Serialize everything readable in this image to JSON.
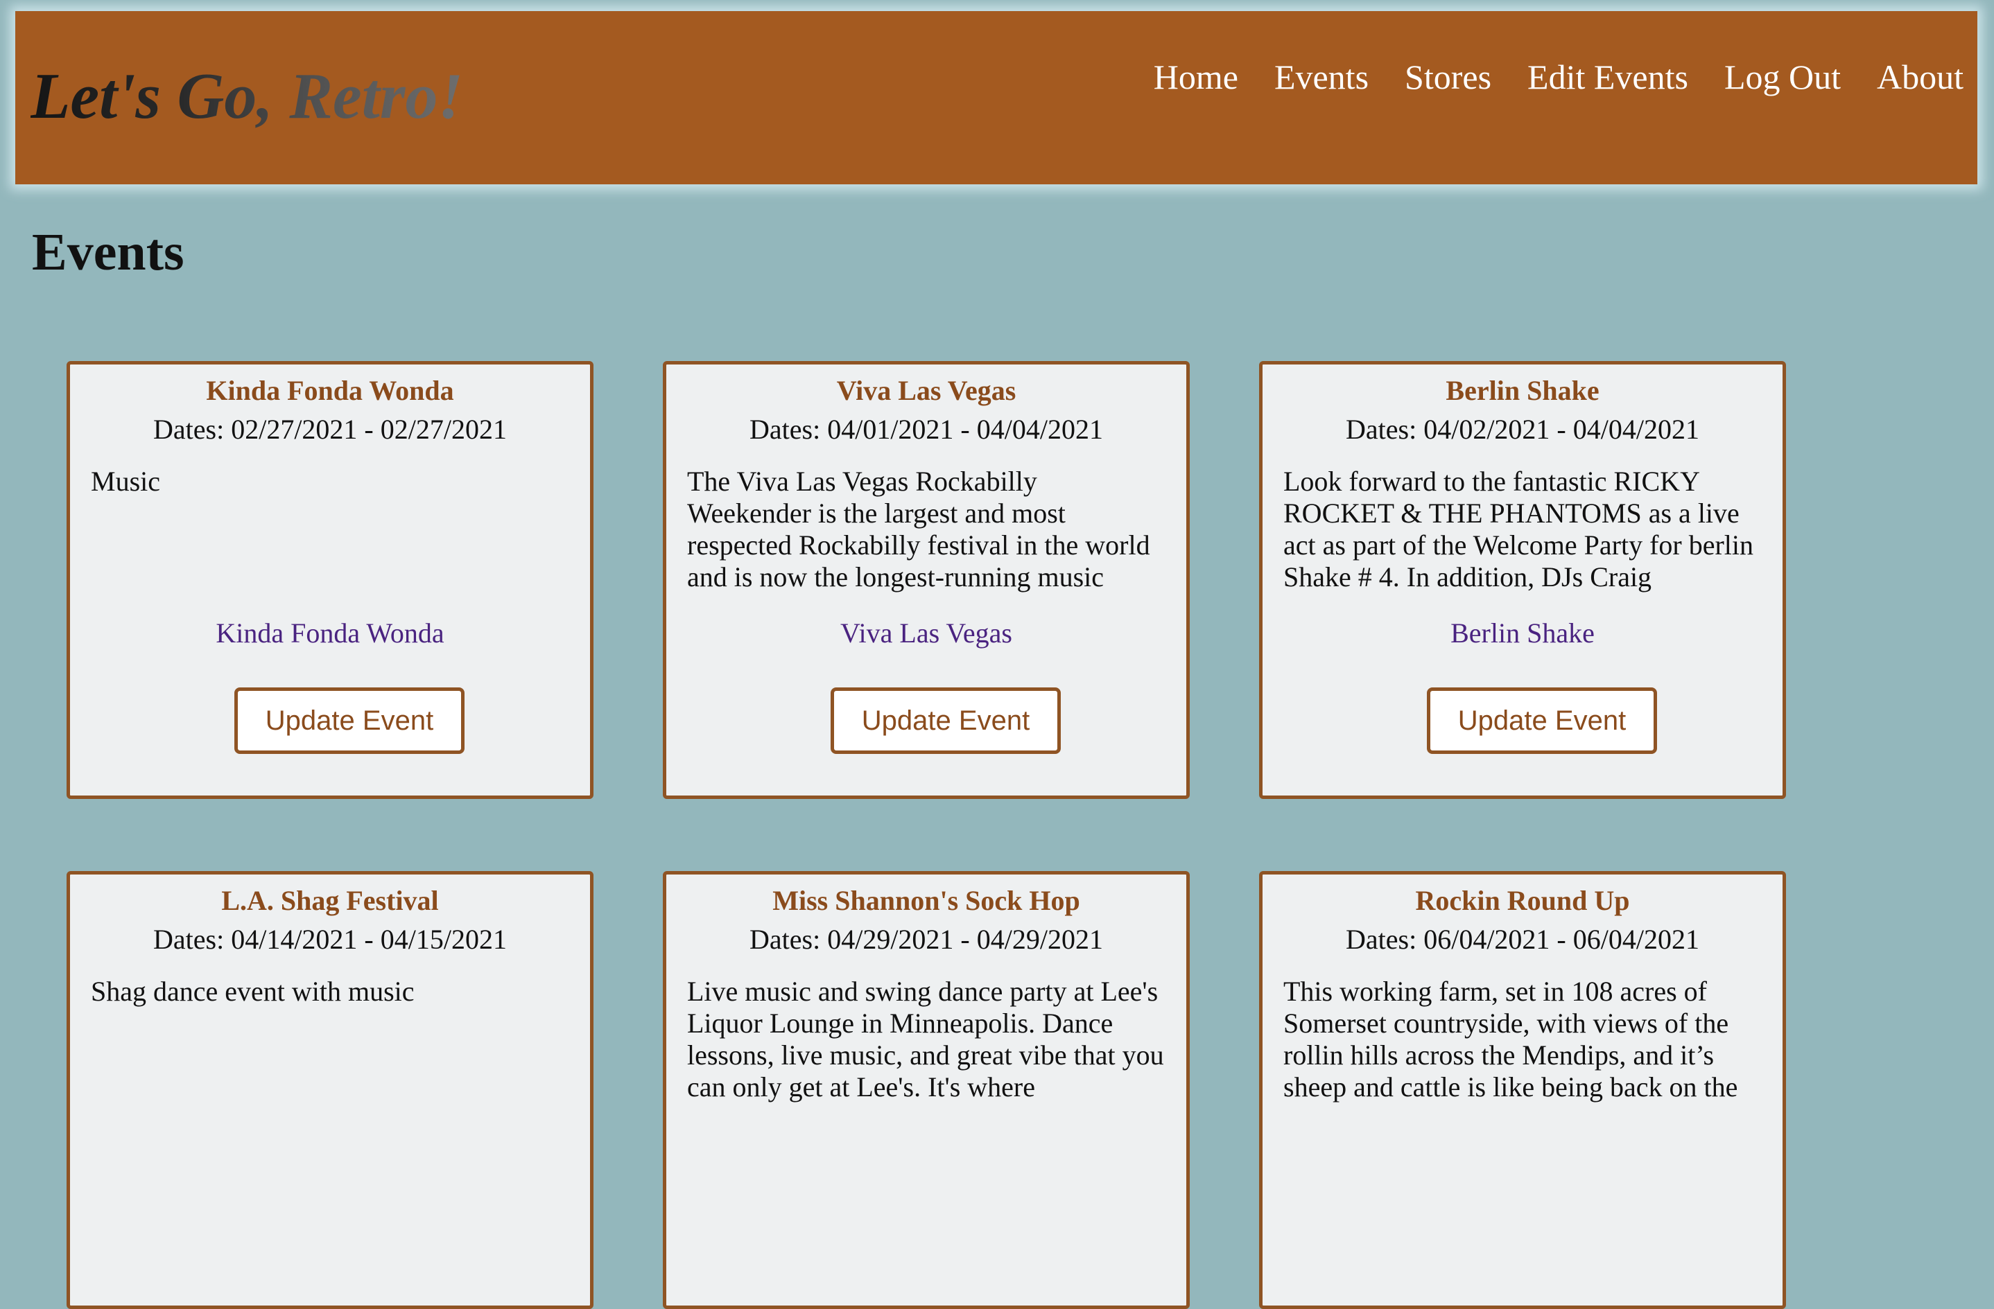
{
  "header": {
    "logo_text": "Let's Go, Retro!",
    "nav": [
      "Home",
      "Events",
      "Stores",
      "Edit Events",
      "Log Out",
      "About"
    ]
  },
  "page": {
    "title": "Events"
  },
  "events": [
    {
      "title": "Kinda Fonda Wonda",
      "dates": "Dates: 02/27/2021 - 02/27/2021",
      "description": "Music",
      "link": "Kinda Fonda Wonda",
      "button": "Update Event"
    },
    {
      "title": "Viva Las Vegas",
      "dates": "Dates: 04/01/2021 - 04/04/2021",
      "description": "The Viva Las Vegas Rockabilly Weekender is the largest and most respected Rockabilly festival in the world and is now the longest-running music",
      "link": "Viva Las Vegas",
      "button": "Update Event"
    },
    {
      "title": "Berlin Shake",
      "dates": "Dates: 04/02/2021 - 04/04/2021",
      "description": "Look forward to the fantastic RICKY ROCKET & THE PHANTOMS as a live act as part of the Welcome Party for berlin Shake # 4. In addition, DJs Craig",
      "link": "Berlin Shake",
      "button": "Update Event"
    },
    {
      "title": "L.A. Shag Festival",
      "dates": "Dates: 04/14/2021 - 04/15/2021",
      "description": "Shag dance event with music",
      "link": "",
      "button": ""
    },
    {
      "title": "Miss Shannon's Sock Hop",
      "dates": "Dates: 04/29/2021 - 04/29/2021",
      "description": "Live music and swing dance party at Lee's Liquor Lounge in Minneapolis. Dance lessons, live music, and great vibe that you can only get at Lee's. It's where",
      "link": "",
      "button": ""
    },
    {
      "title": "Rockin Round Up",
      "dates": "Dates: 06/04/2021 - 06/04/2021",
      "description": "This working farm, set in 108 acres of Somerset countryside, with views of the rollin hills across the Mendips, and it’s sheep and cattle is like being back on the",
      "link": "",
      "button": ""
    }
  ]
}
